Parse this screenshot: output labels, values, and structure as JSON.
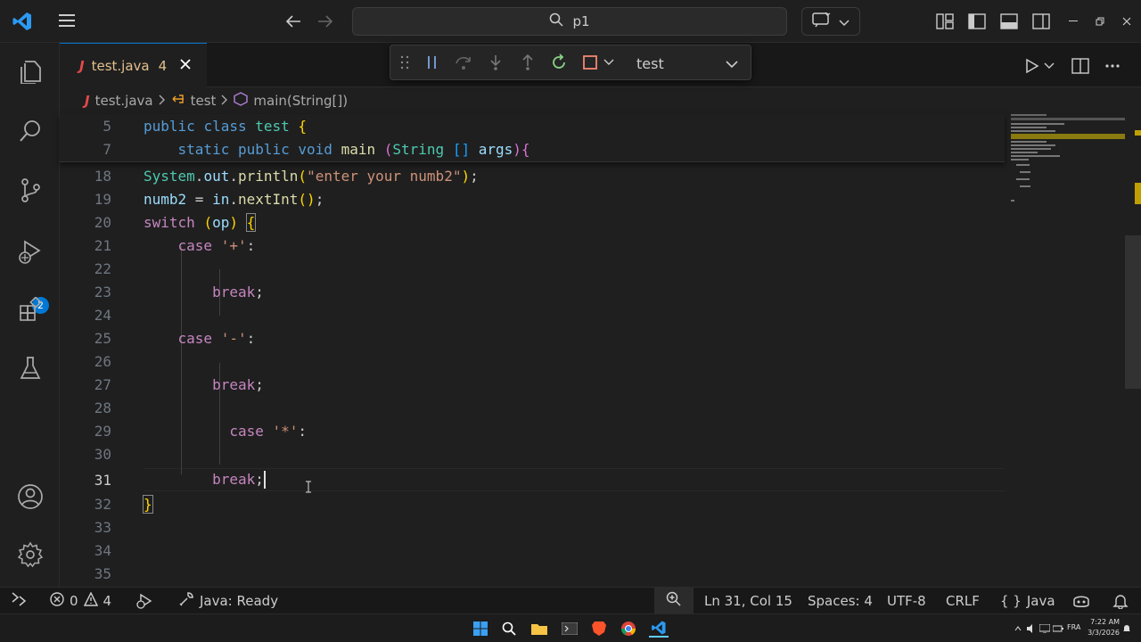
{
  "titlebar": {
    "search_text": "p1"
  },
  "tab": {
    "icon": "J",
    "filename": "test.java",
    "problems_count": "4"
  },
  "debug": {
    "config": "test"
  },
  "breadcrumb": {
    "icon": "J",
    "file": "test.java",
    "class": "test",
    "method": "main(String[])"
  },
  "activity": {
    "debug_badge": "2"
  },
  "editor": {
    "sticky": [
      {
        "ln": "5",
        "code": "public class test {"
      },
      {
        "ln": "7",
        "code": "    static public void main (String [] args){"
      }
    ],
    "lines": [
      {
        "ln": "18",
        "code": "System.out.println(\"enter your numb2\");"
      },
      {
        "ln": "19",
        "code": "numb2 = in.nextInt();"
      },
      {
        "ln": "20",
        "code": "switch (op) {"
      },
      {
        "ln": "21",
        "code": "    case '+':"
      },
      {
        "ln": "22",
        "code": ""
      },
      {
        "ln": "23",
        "code": "        break;"
      },
      {
        "ln": "24",
        "code": ""
      },
      {
        "ln": "25",
        "code": "    case '-':"
      },
      {
        "ln": "26",
        "code": ""
      },
      {
        "ln": "27",
        "code": "        break;"
      },
      {
        "ln": "28",
        "code": ""
      },
      {
        "ln": "29",
        "code": "         case '*':"
      },
      {
        "ln": "30",
        "code": ""
      },
      {
        "ln": "31",
        "code": "        break;"
      },
      {
        "ln": "32",
        "code": "}"
      },
      {
        "ln": "33",
        "code": ""
      },
      {
        "ln": "34",
        "code": ""
      },
      {
        "ln": "35",
        "code": ""
      }
    ]
  },
  "status": {
    "errors": "0",
    "warnings": "4",
    "java_status": "Java: Ready",
    "position": "Ln 31, Col 15",
    "spaces": "Spaces: 4",
    "encoding": "UTF-8",
    "eol": "CRLF",
    "language": "Java"
  },
  "taskbar": {
    "language": "FRA",
    "time": "7:22 AM",
    "date": "3/3/2026"
  },
  "colors": {
    "accent": "#0078d4",
    "keyword": "#569cd6",
    "type": "#4ec9b0",
    "function": "#dcdcaa",
    "variable": "#9cdcfe",
    "string": "#ce9178",
    "control": "#c586c0"
  }
}
